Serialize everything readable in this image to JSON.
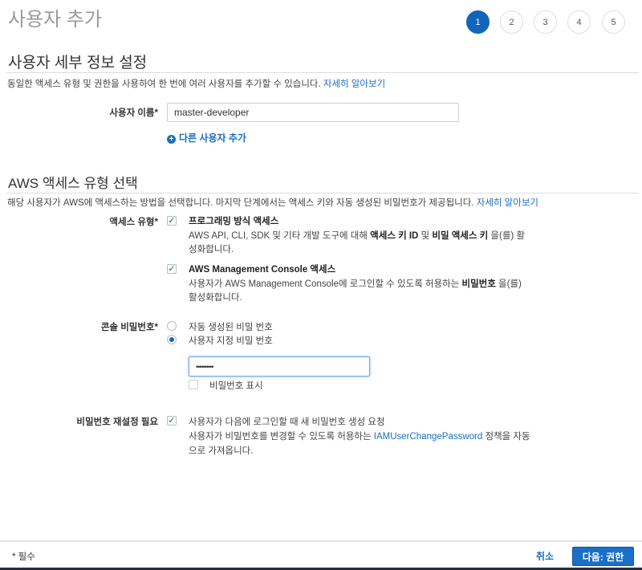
{
  "header": {
    "title": "사용자 추가",
    "steps": [
      "1",
      "2",
      "3",
      "4",
      "5"
    ],
    "active_step": 1
  },
  "details": {
    "heading": "사용자 세부 정보 설정",
    "description": "동일한 액세스 유형 및 권한을 사용하여 한 번에 여러 사용자를 추가할 수 있습니다.",
    "learn_more": "자세히 알아보기",
    "username_label": "사용자 이름*",
    "username_value": "master-developer",
    "add_user_link": "다른 사용자 추가"
  },
  "access": {
    "heading": "AWS 액세스 유형 선택",
    "description": "해당 사용자가 AWS에 액세스하는 방법을 선택합니다. 마지막 단계에서는 액세스 키와 자동 생성된 비밀번호가 제공됩니다.",
    "learn_more": "자세히 알아보기",
    "label": "액세스 유형*",
    "programmatic": {
      "checked": true,
      "title": "프로그래밍 방식 액세스",
      "desc_1": "AWS API, CLI, SDK 및 기타 개발 도구에 대해 ",
      "bold_1": "액세스 키 ID",
      "desc_2": " 및 ",
      "bold_2": "비밀 액세스 키",
      "desc_3": " 을(를) 활",
      "desc_4": "성화합니다."
    },
    "console": {
      "checked": true,
      "title": "AWS Management Console 액세스",
      "desc_1": "사용자가 AWS Management Console에 로그인할 수 있도록 허용하는 ",
      "bold_1": "비밀번호",
      "desc_2": " 을(를)",
      "desc_3": "활성화합니다."
    }
  },
  "password": {
    "label": "콘솔 비밀번호*",
    "option_auto": "자동 생성된 비밀 번호",
    "option_custom": "사용자 지정 비밀 번호",
    "selected": "custom",
    "value": "••••••••••",
    "show_label": "비밀번호 표시",
    "show_checked": false
  },
  "reset": {
    "label": "비밀번호 재설정 필요",
    "checked": true,
    "line1": "사용자가 다음에 로그인할 때 새 비밀번호 생성 요청",
    "line2_a": "사용자가 비밀번호를 변경할 수 있도록 허용하는 ",
    "policy_link": "IAMUserChangePassword",
    "line2_b": " 정책을 자동",
    "line3": "으로 가져옵니다."
  },
  "footer": {
    "required_note": "* 필수",
    "cancel": "취소",
    "next": "다음: 권한"
  }
}
